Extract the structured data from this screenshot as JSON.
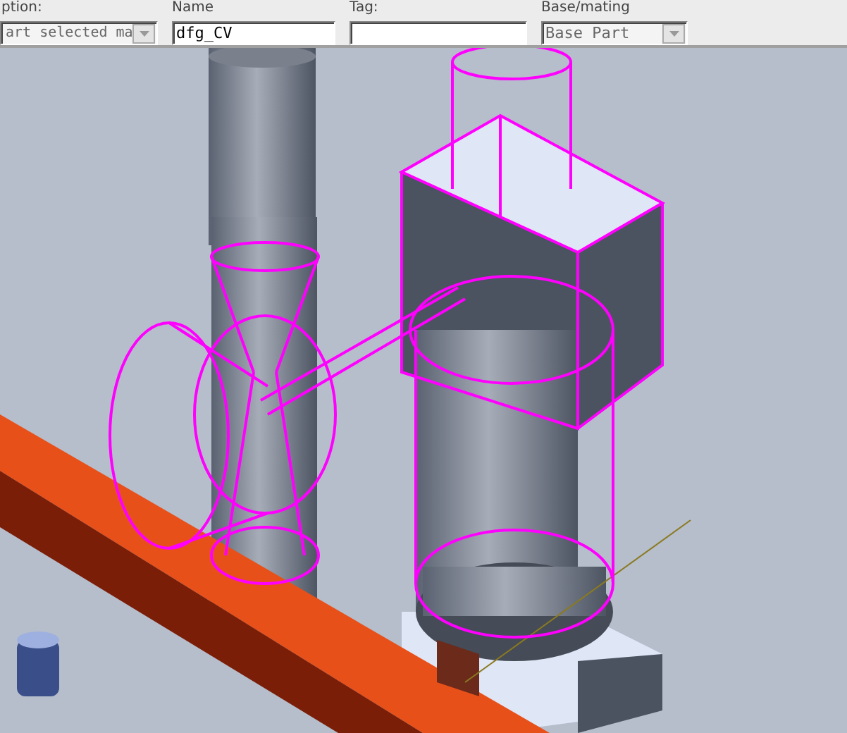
{
  "toolbar": {
    "fields": [
      {
        "kind": "dropdown",
        "label": "ption:",
        "value": "art selected ma",
        "disabled": true
      },
      {
        "kind": "text",
        "label": "Name",
        "value": "dfg_CV"
      },
      {
        "kind": "text",
        "label": "Tag:"
      },
      {
        "kind": "dropdown",
        "label": "Base/mating",
        "value": "Base Part",
        "disabled": true
      }
    ]
  }
}
